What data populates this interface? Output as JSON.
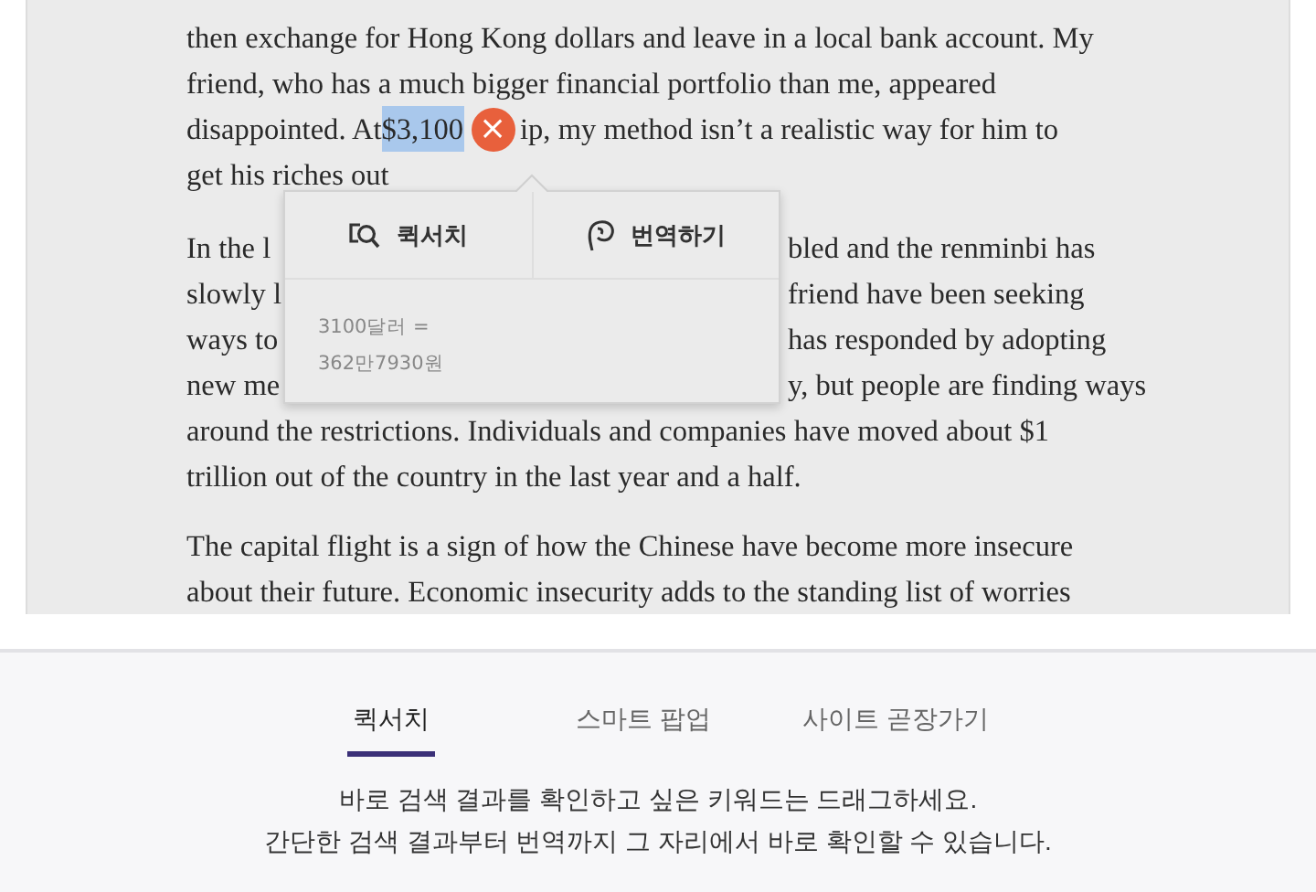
{
  "article": {
    "paragraphs": [
      {
        "lines": [
          {
            "kind": "plain",
            "text": "then exchange for Hong Kong dollars and leave in a local bank account. My"
          },
          {
            "kind": "plain",
            "text": "friend, who has a much bigger financial portfolio than me, appeared"
          },
          {
            "kind": "selection",
            "before": "disappointed. At ",
            "selected": "$3,100",
            "close": "×",
            "after": "ip, my method isn’t a realistic way for him to"
          },
          {
            "kind": "plain",
            "text": "get his riches out"
          }
        ]
      },
      {
        "lines": [
          {
            "kind": "split",
            "left": "In the l",
            "right": "bled and the renminbi has"
          },
          {
            "kind": "split",
            "left": "slowly l",
            "right": "friend have been seeking"
          },
          {
            "kind": "split",
            "left": "ways to",
            "right": "has responded by adopting"
          },
          {
            "kind": "split",
            "left": "new me",
            "right": "y, but people are finding ways"
          },
          {
            "kind": "plain",
            "text": "around the restrictions. Individuals and companies have moved about $1"
          },
          {
            "kind": "plain",
            "text": "trillion out of the country in the last year and a half."
          }
        ]
      },
      {
        "lines": [
          {
            "kind": "plain",
            "text": "The capital flight is a sign of how the Chinese have become more insecure"
          },
          {
            "kind": "plain",
            "text": "about their future. Economic insecurity adds to the standing list of worries"
          }
        ]
      }
    ]
  },
  "popup": {
    "actions": [
      {
        "kind": "quick-search",
        "label": "퀵서치"
      },
      {
        "kind": "translate",
        "label": "번역하기"
      }
    ],
    "result_lines": [
      "3100달러 =",
      "362만7930원"
    ]
  },
  "footer": {
    "tabs": [
      {
        "label": "퀵서치",
        "selected": true
      },
      {
        "label": "스마트 팝업",
        "selected": false
      },
      {
        "label": "사이트 곧장가기",
        "selected": false
      }
    ],
    "description": [
      "바로 검색 결과를 확인하고 싶은 키워드는 드래그하세요.",
      "간단한 검색 결과부터 번역까지 그 자리에서 바로 확인할 수 있습니다."
    ]
  }
}
